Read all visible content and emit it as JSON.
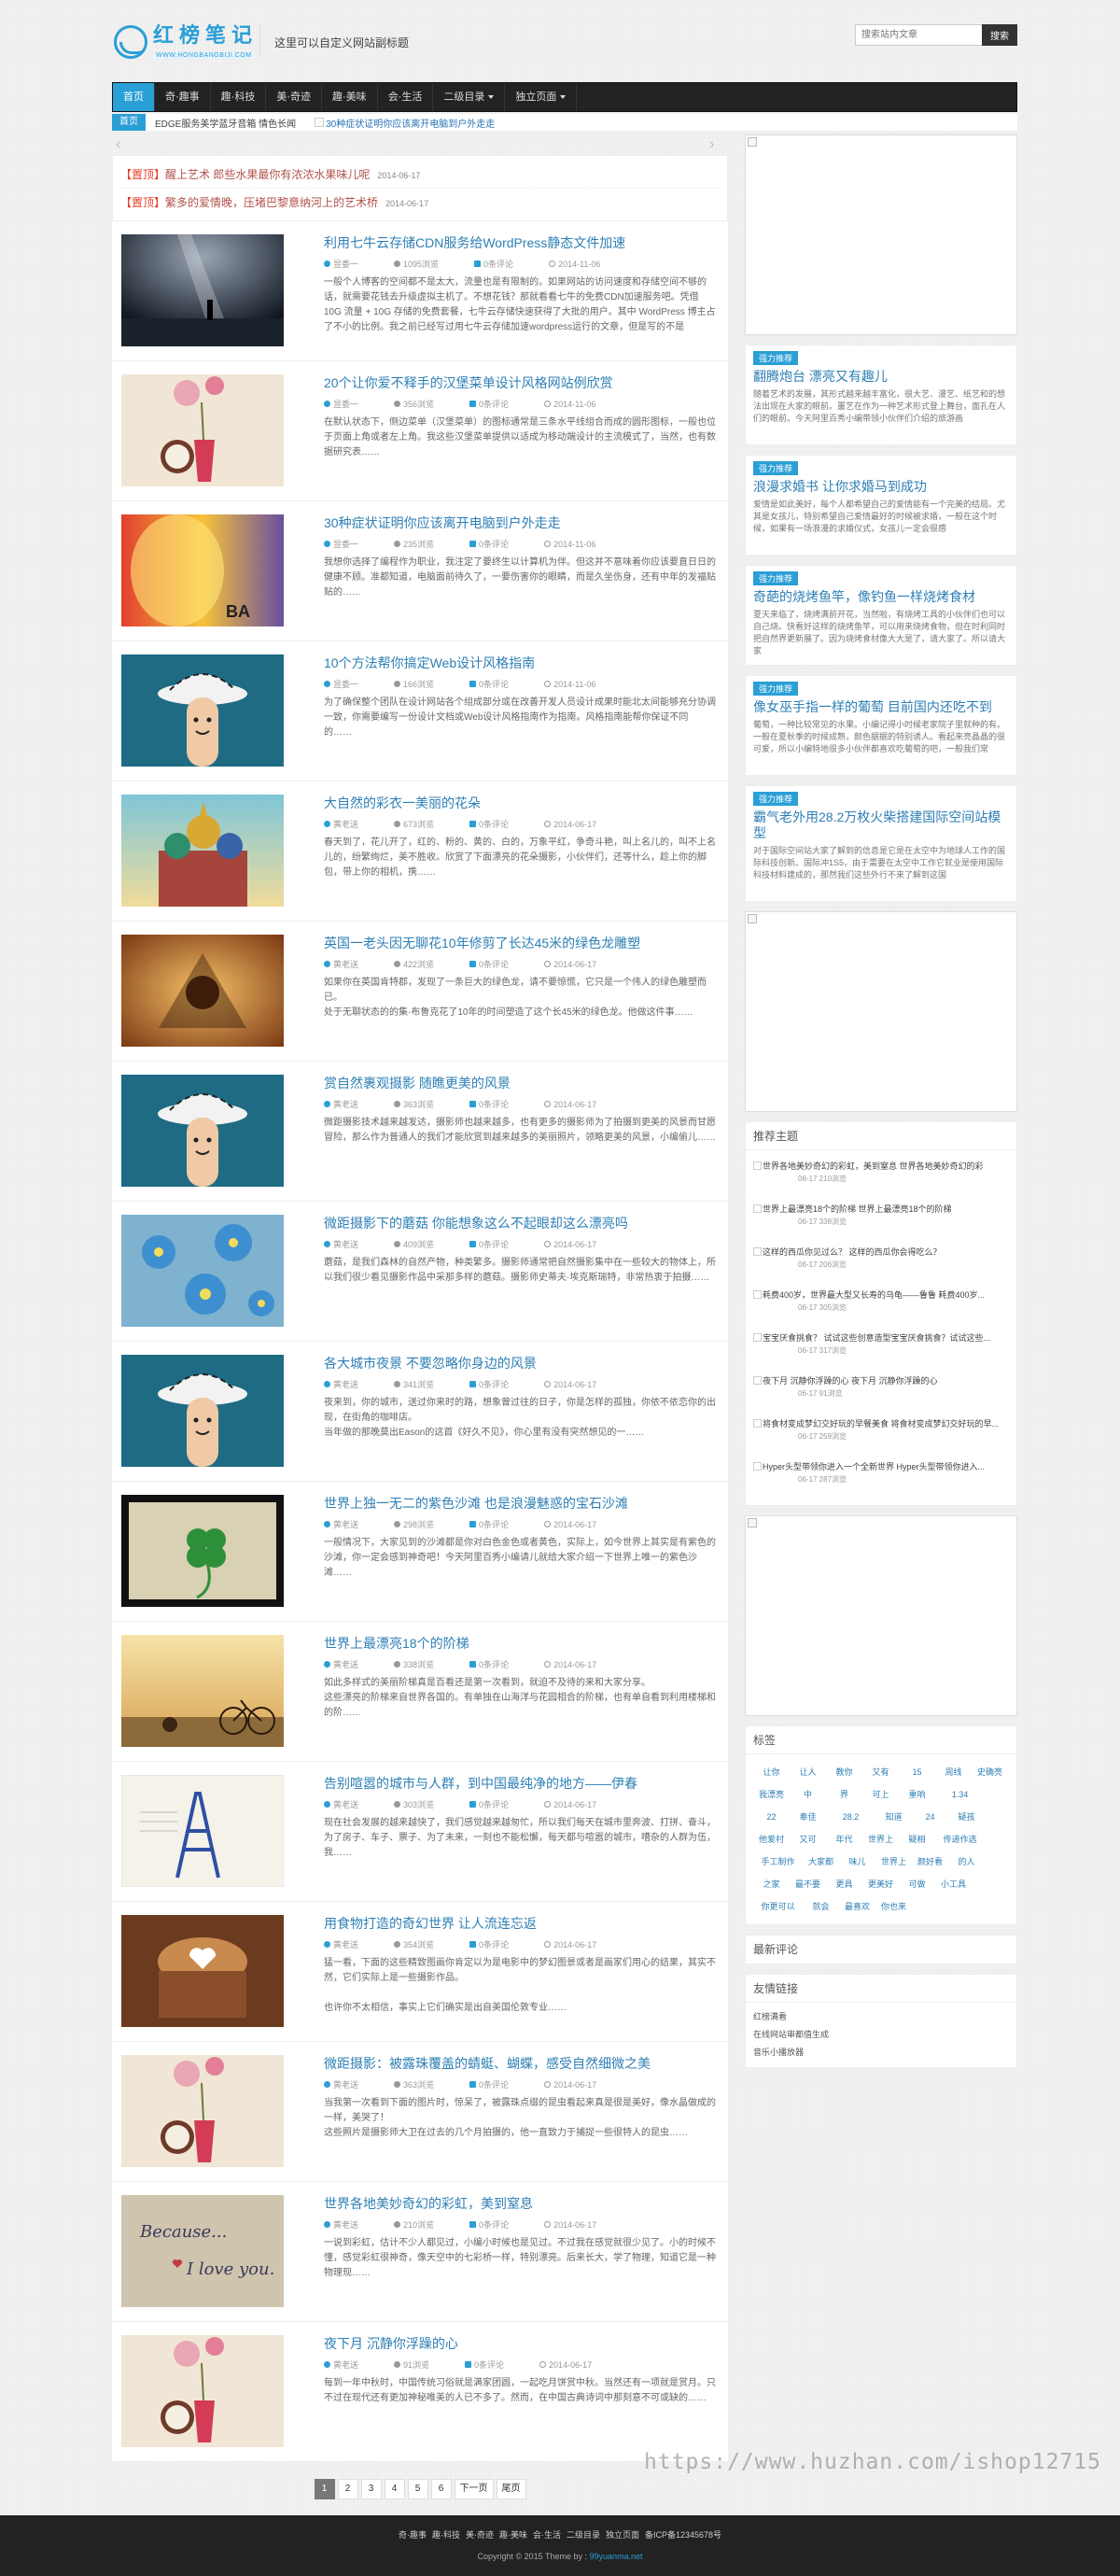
{
  "header": {
    "logo_title": "红榜笔记",
    "logo_sub": "WWW.HONGBANGBIJI.COM",
    "tagline": "这里可以自定义网站副标题",
    "search_placeholder": "搜索站内文章",
    "search_button": "搜索"
  },
  "nav": [
    {
      "label": "首页",
      "active": true,
      "caret": false
    },
    {
      "label": "奇·趣事",
      "active": false,
      "caret": false
    },
    {
      "label": "趣·科技",
      "active": false,
      "caret": false
    },
    {
      "label": "美·奇迹",
      "active": false,
      "caret": false
    },
    {
      "label": "趣·美味",
      "active": false,
      "caret": false
    },
    {
      "label": "会·生活",
      "active": false,
      "caret": false
    },
    {
      "label": "二级目录",
      "active": false,
      "caret": true
    },
    {
      "label": "独立页面",
      "active": false,
      "caret": true
    }
  ],
  "subbar": {
    "home": "首页",
    "link": "EDGE服务美学蓝牙音箱 情色长闻",
    "slide_titles": [
      "30种症状证明你应该离开电脑到户外走走"
    ]
  },
  "sticky": [
    {
      "tag": "【置顶】",
      "title": "醒上艺术 郎些水果最你有浓浓水果味儿呢",
      "date": "2014-06-17"
    },
    {
      "tag": "【置顶】",
      "title": "繁多的爱情晚，压堵巴黎意纳河上的艺术桥",
      "date": "2014-06-17"
    }
  ],
  "posts": [
    {
      "title": "利用七牛云存储CDN服务给WordPress静态文件加速",
      "author": "昱委一",
      "views": "1095浏览",
      "comments": "0条评论",
      "date": "2014-11-06",
      "thumb": "night",
      "excerpt": "一般个人博客的空间都不是太大，流量也是有限制的。如果网站的访问速度和存储空间不够的话，就需要花钱去升级虚拟主机了。不想花钱？那就看看七牛的免费CDN加速服务吧。凭借10G 流量 + 10G 存储的免费套餐，七牛云存储快速获得了大批的用户。其中 WordPress 博主占了不小的比例。我之前已经写过用七牛云存储加速wordpress运行的文章，但是写的不是"
    },
    {
      "title": "20个让你爱不释手的汉堡菜单设计风格网站例欣赏",
      "author": "昱委一",
      "views": "356浏览",
      "comments": "0条评论",
      "date": "2014-11-06",
      "thumb": "vase",
      "excerpt": "在默认状态下，侧边菜单（汉堡菜单）的图标通常是三条水平线组合而成的圆形图标，一般也位于页面上角或者左上角。我这些汉堡菜单提供以适成为移动端设计的主流模式了，当然，也有数据研究表……"
    },
    {
      "title": "30种症状证明你应该离开电脑到户外走走",
      "author": "昱委一",
      "views": "235浏览",
      "comments": "0条评论",
      "date": "2014-11-06",
      "thumb": "balloon",
      "excerpt": "我想你选择了编程作为职业，我注定了要终生以计算机为伴。但这并不意味着你应该要直日日的健康不顾。准都知道，电脑面前待久了，一要伤害你的眼睛，而是久坐伤身，还有中年的发福贴贴的……"
    },
    {
      "title": "10个方法帮你搞定Web设计风格指南",
      "author": "昱委一",
      "views": "166浏览",
      "comments": "0条评论",
      "date": "2014-11-06",
      "thumb": "finger",
      "excerpt": "为了确保整个团队在设计网站各个组成部分或在改善开发人员设计成果时能北太间能够充分协调一致，你需要编写一份设计文档或Web设计风格指南作为指南。风格指南能帮你保证不同的……"
    },
    {
      "title": "大自然的彩衣一美丽的花朵",
      "author": "黄老送",
      "views": "673浏览",
      "comments": "0条评论",
      "date": "2014-06-17",
      "thumb": "church",
      "excerpt": "春天到了，花儿开了，红的、粉的、黄的、白的，万象平红，争奇斗艳，叫上名儿的，叫不上名儿的，纷繁绚烂，美不胜收。欣赏了下面漂亮的花朵摄影，小伙伴们，还等什么，趁上你的脚包，带上你的相机，携……"
    },
    {
      "title": "英国一老头因无聊花10年修剪了长达45米的绿色龙雕塑",
      "author": "黄老送",
      "views": "422浏览",
      "comments": "0条评论",
      "date": "2014-06-17",
      "thumb": "warm",
      "excerpt": "如果你在英国肯特郡，发现了一条巨大的绿色龙，请不要惊慌，它只是一个伟人的绿色雕塑而已。\n处于无聊状态的的集·布鲁克花了10年的时间塑造了这个长45米的绿色龙。他做这件事……"
    },
    {
      "title": "赏自然裹观摄影 随瞧更美的风景",
      "author": "黄老送",
      "views": "363浏览",
      "comments": "0条评论",
      "date": "2014-06-17",
      "thumb": "finger",
      "excerpt": "微距摄影技术越来越发达，摄影师也越来越多，也有更多的摄影师为了拍摄到更美的风景而甘愿冒险，那么作为普通人的我们才能欣赏到越来越多的美丽照片，领略更美的风景，小编偷儿……"
    },
    {
      "title": "微距摄影下的蘑菇 你能想象这么不起眼却这么漂亮吗",
      "author": "黄老送",
      "views": "409浏览",
      "comments": "0条评论",
      "date": "2014-06-17",
      "thumb": "flower",
      "excerpt": "蘑菇，是我们森林的自然产物，种类繁多。摄影师通常把自然摄影集中在一些较大的物体上，所以我们很少看见摄影作品中采那多样的蘑菇。摄影师史蒂夫·埃克斯瑞特，非常热衷于拍摄……"
    },
    {
      "title": "各大城市夜景 不要忽略你身边的风景",
      "author": "黄老送",
      "views": "341浏览",
      "comments": "0条评论",
      "date": "2014-06-17",
      "thumb": "finger",
      "excerpt": "夜来到，你的城市，送过你来时的路，想象曾过往的日子，你是怎样的孤独，你依不依恋你的出现，在街角的咖啡店。\n当年做的那晚莫出Eason的这首《好久不见》，你心里有没有突然想见的一……"
    },
    {
      "title": "世界上独一无二的紫色沙滩 也是浪漫魅惑的宝石沙滩",
      "author": "黄老送",
      "views": "298浏览",
      "comments": "0条评论",
      "date": "2014-06-17",
      "thumb": "clover",
      "excerpt": "一般情况下，大家见到的沙滩都是你对白色金色或者黄色，实际上，如今世界上其实是有紫色的沙滩，你一定会感到神奇吧！今天阿里百秀小编请儿就给大家介绍一下世界上唯一的紫色沙滩……"
    },
    {
      "title": "世界上最漂亮18个的阶梯",
      "author": "黄老送",
      "views": "338浏览",
      "comments": "0条评论",
      "date": "2014-06-17",
      "thumb": "bike",
      "excerpt": "如此多样式的美丽阶梯真是百看还是第一次看到，就迫不及待的来和大家分享。\n这些漂亮的阶梯来自世界各国的。有单独在山海洋与花园相合的阶梯，也有单自看到利用楼梯和的阶……"
    },
    {
      "title": "告别喧嚣的城市与人群，到中国最纯净的地方——伊春",
      "author": "黄老送",
      "views": "303浏览",
      "comments": "0条评论",
      "date": "2014-06-17",
      "thumb": "eiffel",
      "excerpt": "现在社会发展的越来越快了，我们感觉越来越匆忙，所以我们每天在城市里奔波、打拼、奋斗，为了房子、车子、票子、为了未来，一刻也不能松懈，每天都与喧嚣的城市，嘈杂的人群为伍，我……"
    },
    {
      "title": "用食物打造的奇幻世界 让人流连忘返",
      "author": "黄老送",
      "views": "354浏览",
      "comments": "0条评论",
      "date": "2014-06-17",
      "thumb": "latte",
      "excerpt": "猛一看，下面的这些精致图画你肯定以为是电影中的梦幻图景或者是画家们用心的结果，其实不然，它们实际上是一些摄影作品。\n\n也许你不太相信，事实上它们确实是出自美国伦敦专业……"
    },
    {
      "title": "微距摄影：被露珠覆盖的蜻蜓、蝴蝶，感受自然细微之美",
      "author": "黄老送",
      "views": "363浏览",
      "comments": "0条评论",
      "date": "2014-06-17",
      "thumb": "vase",
      "excerpt": "当我第一次看到下面的图片时，惊呆了，被露珠点缀的昆虫看起来真是很是美好，像水晶做成的一样，美哭了！\n这些照片是摄影师大卫在过去的几个月拍摄的，他一直致力于捕捉一些很特人的昆虫……"
    },
    {
      "title": "世界各地美妙奇幻的彩虹，美到窒息",
      "author": "黄老送",
      "views": "210浏览",
      "comments": "0条评论",
      "date": "2014-06-17",
      "thumb": "note",
      "excerpt": "一说到彩虹，估计不少人都见过，小编小时候也是见过。不过我在感觉就很少见了。小的时候不懂，感觉彩虹很神奇，像天空中的七彩桥一样，特别漂亮。后来长大，学了物理，知道它是一种物理现……"
    },
    {
      "title": "夜下月 沉静你浮躁的心",
      "author": "黄老送",
      "views": "91浏览",
      "comments": "0条评论",
      "date": "2014-06-17",
      "thumb": "vase",
      "excerpt": "每到一年中秋时，中国传统习俗就是满家团圆，一起吃月饼赏中秋。当然还有一项就是赏月。只不过在现代还有更加神秘唯美的人已不多了。然而，在中国古典诗词中那刻意不可或缺的……"
    }
  ],
  "pagination": [
    "1",
    "2",
    "3",
    "4",
    "5",
    "6",
    "下一页",
    "尾页"
  ],
  "sidebar": {
    "recommend_label": "强力推荐",
    "recommended": [
      {
        "title": "翻腾炮台 漂亮又有趣儿",
        "text": "随着艺术的发展，其形式越来越丰富化，很大艺、漫艺、纸艺和的想法出现在大家的眼前。噩艺在作为一种艺术形式登上舞台，面孔在人们的眼前。今天阿里百秀小编带领小伙伴们介绍的旅游画"
      },
      {
        "title": "浪漫求婚书 让你求婚马到成功",
        "text": "爱情是如此美好，每个人都希望自己的爱情能有一个完美的结局。尤其是女孩儿，特别希望自己爱情最好的时候被求婚，一般在这个时候，如果有一场浪漫的求婚仪式，女孩儿一定会很感"
      },
      {
        "title": "奇葩的烧烤鱼竿，像钓鱼一样烧烤食材",
        "text": "夏天来临了，烧烤满前开花，当然啦，有烧烤工具的小伙伴们也可以自己烧。快看好这样的烧烤鱼竿，可以用来烧烤食物，但在时利同时把自然界更新展了。因为烧烤食材像大大是了，请大家了。所以请大家"
      },
      {
        "title": "像女巫手指一样的葡萄 目前国内还吃不到",
        "text": "葡萄，一种比较常见的水果。小编记得小时候老家院子里就种的有。一般在夏秋季的时候成熟，颜色据据的特别诱人。看起来亮晶晶的很可爱，所以小编特地很多小伙伴都喜欢吃葡萄的吧，一般我们常"
      },
      {
        "title": "霸气老外用28.2万枚火柴搭建国际空间站模型",
        "text": "对于国际空间站大家了解到的信息是它是在太空中为地球人工作的国际科技创新。国际冲1S5，由于需要在太空中工作它就业是使用国际科技材料建成的，那然我们这些外行不来了解到这国"
      }
    ],
    "hot_title": "推荐主题",
    "hot": [
      {
        "text": "世界各地美妙奇幻的彩虹，美到窒息 世界各地美妙奇幻的彩",
        "meta": "06-17  210浏览"
      },
      {
        "text": "世界上最漂亮18个的阶梯  世界上最漂亮18个的阶梯",
        "meta": "06-17  338浏览"
      },
      {
        "text": "这样的西瓜你见过么？ 这样的西瓜你会得吃么？",
        "meta": "06-17  206浏览"
      },
      {
        "text": "耗费400岁，世界最大型又长寿的乌龟——鲁鲁  耗费400岁...",
        "meta": "06-17  305浏览"
      },
      {
        "text": "宝宝厌食挑食？ 试试这些创意造型宝宝厌食挑食？试试这些...",
        "meta": "06-17  317浏览"
      },
      {
        "text": "夜下月 沉静你浮躁的心  夜下月 沉静你浮躁的心",
        "meta": "06-17  91浏览"
      },
      {
        "text": "将食材变成梦幻交好玩的早餐美食 将食材变成梦幻交好玩的早...",
        "meta": "06-17  259浏览"
      },
      {
        "text": "Hyper头型带领你进入一个全新世界  Hyper头型带领你进入...",
        "meta": "06-17  287浏览"
      }
    ],
    "tags_title": "标签",
    "tags": [
      "让你",
      "让人",
      "教你",
      "又有",
      "15",
      "周线",
      "史确亮",
      "我漂亮",
      "中",
      "界",
      "可上",
      "重响",
      "1.34",
      "22",
      "奉佳",
      "28.2",
      "知道",
      "24",
      "疑孩",
      "他爱村",
      "又可",
      "年代",
      "世界上",
      "疑相",
      "传递作选",
      "手工制作",
      "大家都",
      "味儿",
      "世界上",
      "颜好看",
      "的人",
      "之家",
      "最不要",
      "更具",
      "更美好",
      "可做",
      "小工具",
      "你更可以",
      "就会",
      "最喜欢",
      "你也来"
    ],
    "comments_title": "最新评论",
    "links_title": "友情链接",
    "links": [
      "红榜满看",
      "在线网站审都值生成",
      "音乐小播放器"
    ]
  },
  "footer": {
    "links": [
      "奇·趣事",
      "趣·科技",
      "美·奇迹",
      "趣·美味",
      "会·生活",
      "二级目录",
      "独立页面",
      "备ICP备12345678号"
    ],
    "copy_prefix": "Copyright © 2015 Theme by :",
    "copy_site": "99yuanma.net"
  },
  "watermark": "https://www.huzhan.com/ishop12715"
}
